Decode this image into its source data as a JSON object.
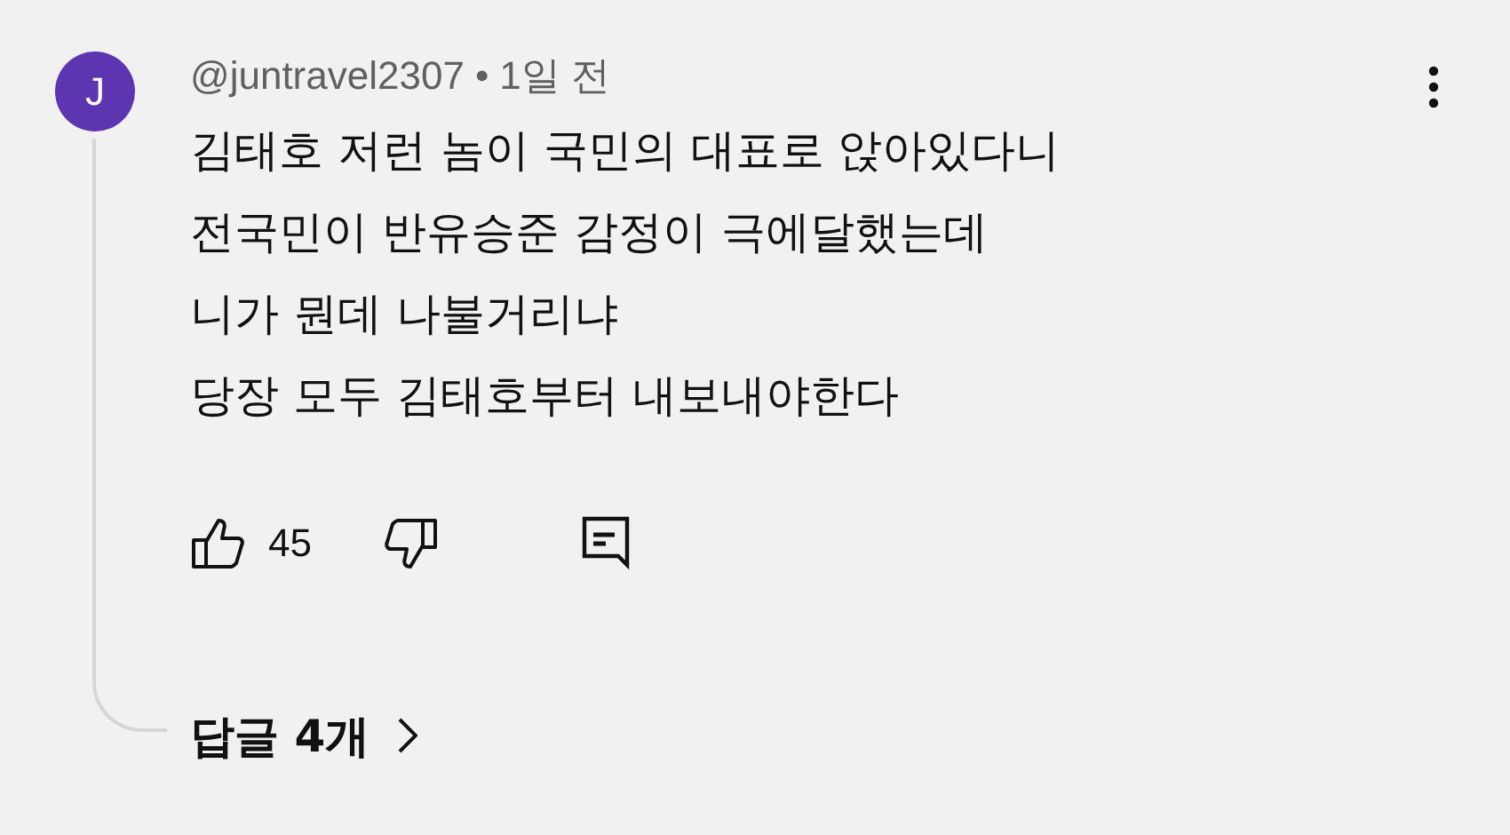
{
  "comment": {
    "avatar_letter": "J",
    "author": "@juntravel2307",
    "separator": "•",
    "time": "1일 전",
    "lines": [
      "김태호 저런 놈이 국민의 대표로 앉아있다니",
      "전국민이 반유승준 감정이 극에달했는데",
      "니가 뭔데 나불거리냐",
      "당장 모두 김태호부터 내보내야한다"
    ],
    "like_count": "45",
    "replies": "답글 4개"
  }
}
